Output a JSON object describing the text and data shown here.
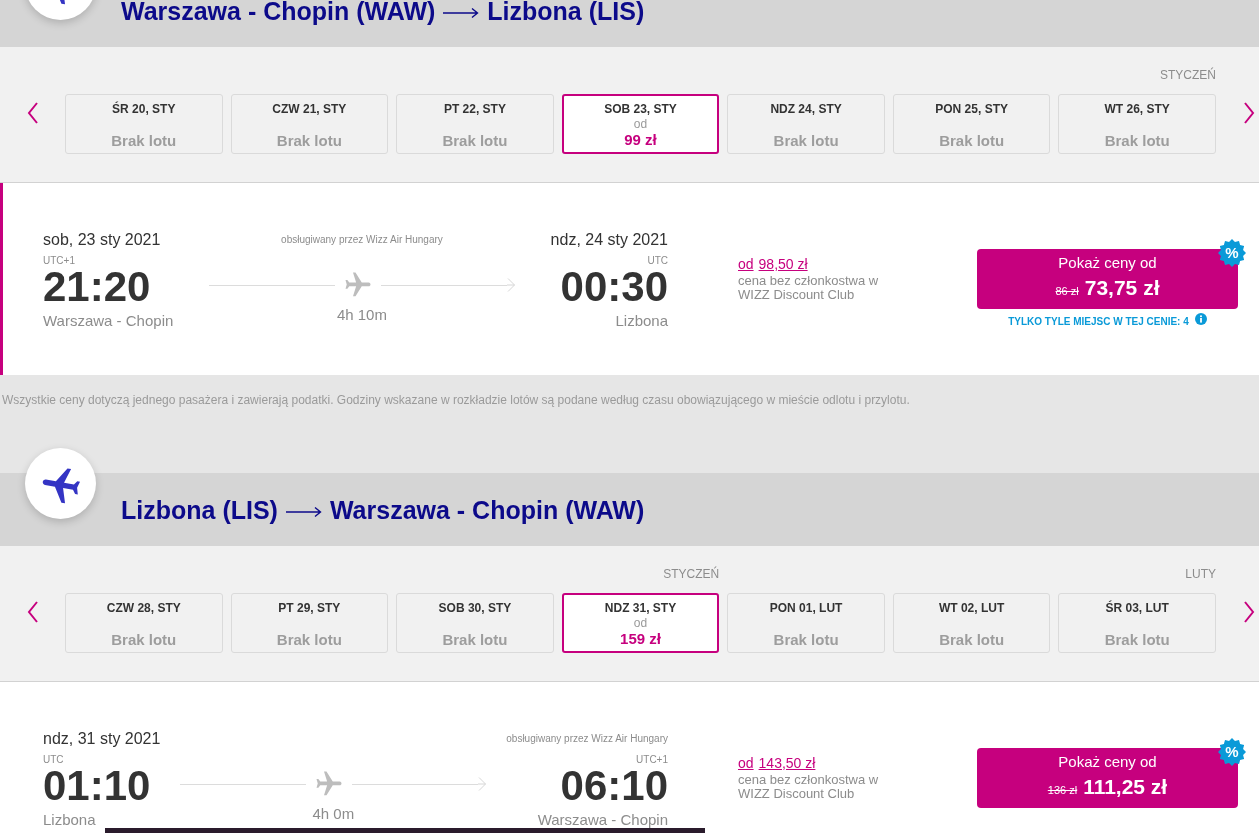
{
  "segments": [
    {
      "header": {
        "from": "Warszawa - Chopin (WAW)",
        "to": "Lizbona (LIS)"
      },
      "date_strip": {
        "days": [
          {
            "label": "ŚR 20, STY",
            "status": "Brak lotu",
            "selected": false
          },
          {
            "label": "CZW 21, STY",
            "status": "Brak lotu",
            "selected": false
          },
          {
            "label": "PT 22, STY",
            "status": "Brak lotu",
            "selected": false
          },
          {
            "label": "SOB 23, STY",
            "from_label": "od",
            "price": "99 zł",
            "selected": true
          },
          {
            "label": "NDZ 24, STY",
            "status": "Brak lotu",
            "selected": false
          },
          {
            "label": "PON 25, STY",
            "status": "Brak lotu",
            "selected": false
          },
          {
            "label": "WT 26, STY",
            "status": "Brak lotu",
            "selected": false,
            "month_label": "STYCZEŃ"
          }
        ]
      },
      "flight": {
        "selected": true,
        "departure": {
          "date": "sob, 23 sty 2021",
          "timezone": "UTC+1",
          "time": "21:20",
          "airport": "Warszawa - Chopin"
        },
        "route": {
          "operated_by": "obsługiwany przez Wizz Air Hungary",
          "duration": "4h 10m"
        },
        "arrival": {
          "date": "ndz, 24 sty 2021",
          "timezone": "UTC",
          "time": "00:30",
          "airport": "Lizbona"
        },
        "member_price": {
          "prefix": "od",
          "price": "98,50 zł",
          "note": "cena bez członkostwa w WIZZ Discount Club"
        },
        "price_button": {
          "label": "Pokaż ceny od",
          "old_price": "86 zł",
          "price": "73,75 zł",
          "badge": "%"
        },
        "seats_note": "TYLKO TYLE MIEJSC W TEJ CENIE: 4"
      },
      "footnote": "Wszystkie ceny dotyczą jednego pasażera i zawierają podatki. Godziny wskazane w rozkładzie lotów są podane według czasu obowiązującego w mieście odlotu i przylotu."
    },
    {
      "header": {
        "from": "Lizbona (LIS)",
        "to": "Warszawa - Chopin (WAW)"
      },
      "date_strip": {
        "days": [
          {
            "label": "CZW 28, STY",
            "status": "Brak lotu",
            "selected": false
          },
          {
            "label": "PT 29, STY",
            "status": "Brak lotu",
            "selected": false
          },
          {
            "label": "SOB 30, STY",
            "status": "Brak lotu",
            "selected": false
          },
          {
            "label": "NDZ 31, STY",
            "from_label": "od",
            "price": "159 zł",
            "selected": true,
            "month_label": "STYCZEŃ"
          },
          {
            "label": "PON 01, LUT",
            "status": "Brak lotu",
            "selected": false
          },
          {
            "label": "WT 02, LUT",
            "status": "Brak lotu",
            "selected": false
          },
          {
            "label": "ŚR 03, LUT",
            "status": "Brak lotu",
            "selected": false,
            "month_label": "LUTY"
          }
        ]
      },
      "flight": {
        "selected": false,
        "departure": {
          "date": "ndz, 31 sty 2021",
          "timezone": "UTC",
          "time": "01:10",
          "airport": "Lizbona"
        },
        "route": {
          "duration": "4h 0m"
        },
        "arrival": {
          "operated_by": "obsługiwany przez Wizz Air Hungary",
          "timezone": "UTC+1",
          "time": "06:10",
          "airport": "Warszawa - Chopin"
        },
        "member_price": {
          "prefix": "od",
          "price": "143,50 zł",
          "note": "cena bez członkostwa w WIZZ Discount Club"
        },
        "price_button": {
          "label": "Pokaż ceny od",
          "old_price": "136 zł",
          "price": "111,25 zł",
          "badge": "%"
        }
      }
    }
  ]
}
